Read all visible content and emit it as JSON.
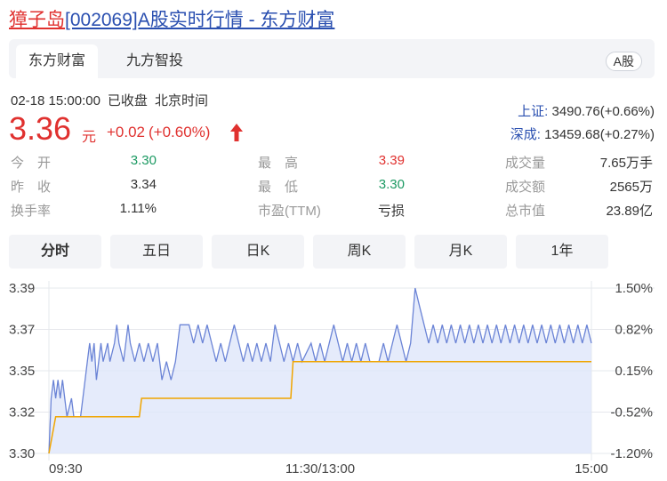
{
  "header": {
    "stock_name": "獐子岛",
    "title_rest": "[002069]A股实时行情 - 东方财富"
  },
  "tabs": [
    {
      "label": "东方财富",
      "active": true
    },
    {
      "label": "九方智投",
      "active": false
    }
  ],
  "badge": "A股",
  "status": {
    "date_time": "02-18 15:00:00",
    "state": "已收盘",
    "timezone": "北京时间"
  },
  "quote": {
    "price": "3.36",
    "unit": "元",
    "change": "+0.02",
    "change_pct": "(+0.60%)",
    "direction": "up"
  },
  "indices": [
    {
      "label": "上证:",
      "value": "3490.76(+0.66%)"
    },
    {
      "label": "深成:",
      "value": "13459.68(+0.27%)"
    }
  ],
  "stats": [
    [
      {
        "label": "今　开",
        "value": "3.30",
        "color": "green"
      },
      {
        "label": "昨　收",
        "value": "3.34",
        "color": "dark"
      },
      {
        "label": "换手率",
        "value": "1.11%",
        "color": "dark"
      }
    ],
    [
      {
        "label": "最　高",
        "value": "3.39",
        "color": "red"
      },
      {
        "label": "最　低",
        "value": "3.30",
        "color": "green"
      },
      {
        "label": "市盈(TTM)",
        "value": "亏损",
        "color": "dark"
      }
    ],
    [
      {
        "label": "成交量",
        "value": "7.65万手",
        "color": "dark"
      },
      {
        "label": "成交额",
        "value": "2565万",
        "color": "dark"
      },
      {
        "label": "总市值",
        "value": "23.89亿",
        "color": "dark"
      }
    ]
  ],
  "period_buttons": [
    {
      "label": "分时",
      "active": true
    },
    {
      "label": "五日",
      "active": false
    },
    {
      "label": "日K",
      "active": false
    },
    {
      "label": "周K",
      "active": false
    },
    {
      "label": "月K",
      "active": false
    },
    {
      "label": "1年",
      "active": false
    }
  ],
  "colors": {
    "up": "#e0312f",
    "down": "#1d9a63",
    "link": "#2a4fb0",
    "price_line": "#6b84d6",
    "avg_line": "#f0a500"
  },
  "chart_data": {
    "type": "line",
    "y_ticks": [
      "3.39",
      "3.37",
      "3.35",
      "3.32",
      "3.30"
    ],
    "y_ticks_right": [
      "1.50%",
      "0.82%",
      "0.15%",
      "-0.52%",
      "-1.20%"
    ],
    "x_ticks": [
      "09:30",
      "11:30/13:00",
      "15:00"
    ],
    "ylim": [
      3.3,
      3.39
    ],
    "total_minutes": 240,
    "series": [
      {
        "kind": "price",
        "points": [
          [
            0,
            3.3
          ],
          [
            1,
            3.33
          ],
          [
            2,
            3.34
          ],
          [
            3,
            3.33
          ],
          [
            4,
            3.34
          ],
          [
            5,
            3.33
          ],
          [
            6,
            3.34
          ],
          [
            7,
            3.33
          ],
          [
            8,
            3.32
          ],
          [
            10,
            3.33
          ],
          [
            11,
            3.32
          ],
          [
            14,
            3.32
          ],
          [
            16,
            3.34
          ],
          [
            17,
            3.35
          ],
          [
            18,
            3.36
          ],
          [
            19,
            3.35
          ],
          [
            20,
            3.36
          ],
          [
            21,
            3.34
          ],
          [
            23,
            3.36
          ],
          [
            24,
            3.35
          ],
          [
            26,
            3.36
          ],
          [
            27,
            3.35
          ],
          [
            29,
            3.36
          ],
          [
            30,
            3.37
          ],
          [
            31,
            3.36
          ],
          [
            33,
            3.35
          ],
          [
            35,
            3.37
          ],
          [
            36,
            3.36
          ],
          [
            38,
            3.35
          ],
          [
            40,
            3.36
          ],
          [
            42,
            3.35
          ],
          [
            44,
            3.36
          ],
          [
            46,
            3.35
          ],
          [
            48,
            3.36
          ],
          [
            50,
            3.34
          ],
          [
            52,
            3.35
          ],
          [
            54,
            3.34
          ],
          [
            56,
            3.35
          ],
          [
            58,
            3.37
          ],
          [
            62,
            3.37
          ],
          [
            64,
            3.36
          ],
          [
            66,
            3.37
          ],
          [
            68,
            3.36
          ],
          [
            70,
            3.37
          ],
          [
            72,
            3.36
          ],
          [
            74,
            3.35
          ],
          [
            76,
            3.36
          ],
          [
            78,
            3.35
          ],
          [
            80,
            3.36
          ],
          [
            82,
            3.37
          ],
          [
            84,
            3.36
          ],
          [
            86,
            3.35
          ],
          [
            88,
            3.36
          ],
          [
            90,
            3.35
          ],
          [
            92,
            3.36
          ],
          [
            94,
            3.35
          ],
          [
            96,
            3.36
          ],
          [
            98,
            3.35
          ],
          [
            100,
            3.37
          ],
          [
            102,
            3.36
          ],
          [
            104,
            3.35
          ],
          [
            106,
            3.36
          ],
          [
            108,
            3.35
          ],
          [
            110,
            3.36
          ],
          [
            112,
            3.35
          ],
          [
            116,
            3.36
          ],
          [
            118,
            3.35
          ],
          [
            120,
            3.36
          ],
          [
            122,
            3.35
          ],
          [
            124,
            3.36
          ],
          [
            126,
            3.37
          ],
          [
            128,
            3.36
          ],
          [
            130,
            3.35
          ],
          [
            132,
            3.36
          ],
          [
            134,
            3.35
          ],
          [
            136,
            3.36
          ],
          [
            138,
            3.35
          ],
          [
            140,
            3.36
          ],
          [
            142,
            3.35
          ],
          [
            146,
            3.35
          ],
          [
            148,
            3.36
          ],
          [
            150,
            3.35
          ],
          [
            152,
            3.36
          ],
          [
            154,
            3.37
          ],
          [
            156,
            3.36
          ],
          [
            158,
            3.35
          ],
          [
            160,
            3.36
          ],
          [
            162,
            3.39
          ],
          [
            164,
            3.38
          ],
          [
            166,
            3.37
          ],
          [
            168,
            3.36
          ],
          [
            170,
            3.37
          ],
          [
            172,
            3.36
          ],
          [
            174,
            3.37
          ],
          [
            176,
            3.36
          ],
          [
            178,
            3.37
          ],
          [
            180,
            3.36
          ],
          [
            182,
            3.37
          ],
          [
            184,
            3.36
          ],
          [
            186,
            3.37
          ],
          [
            188,
            3.36
          ],
          [
            190,
            3.37
          ],
          [
            192,
            3.36
          ],
          [
            194,
            3.37
          ],
          [
            196,
            3.36
          ],
          [
            198,
            3.37
          ],
          [
            200,
            3.36
          ],
          [
            202,
            3.37
          ],
          [
            204,
            3.36
          ],
          [
            206,
            3.37
          ],
          [
            208,
            3.36
          ],
          [
            210,
            3.37
          ],
          [
            212,
            3.36
          ],
          [
            214,
            3.37
          ],
          [
            216,
            3.36
          ],
          [
            218,
            3.37
          ],
          [
            220,
            3.36
          ],
          [
            222,
            3.37
          ],
          [
            224,
            3.36
          ],
          [
            226,
            3.37
          ],
          [
            228,
            3.36
          ],
          [
            230,
            3.37
          ],
          [
            232,
            3.36
          ],
          [
            234,
            3.37
          ],
          [
            236,
            3.36
          ],
          [
            238,
            3.37
          ],
          [
            240,
            3.36
          ]
        ]
      },
      {
        "kind": "average",
        "points": [
          [
            0,
            3.3
          ],
          [
            3,
            3.32
          ],
          [
            40,
            3.32
          ],
          [
            41,
            3.33
          ],
          [
            107,
            3.33
          ],
          [
            108,
            3.35
          ],
          [
            240,
            3.35
          ]
        ]
      }
    ]
  }
}
